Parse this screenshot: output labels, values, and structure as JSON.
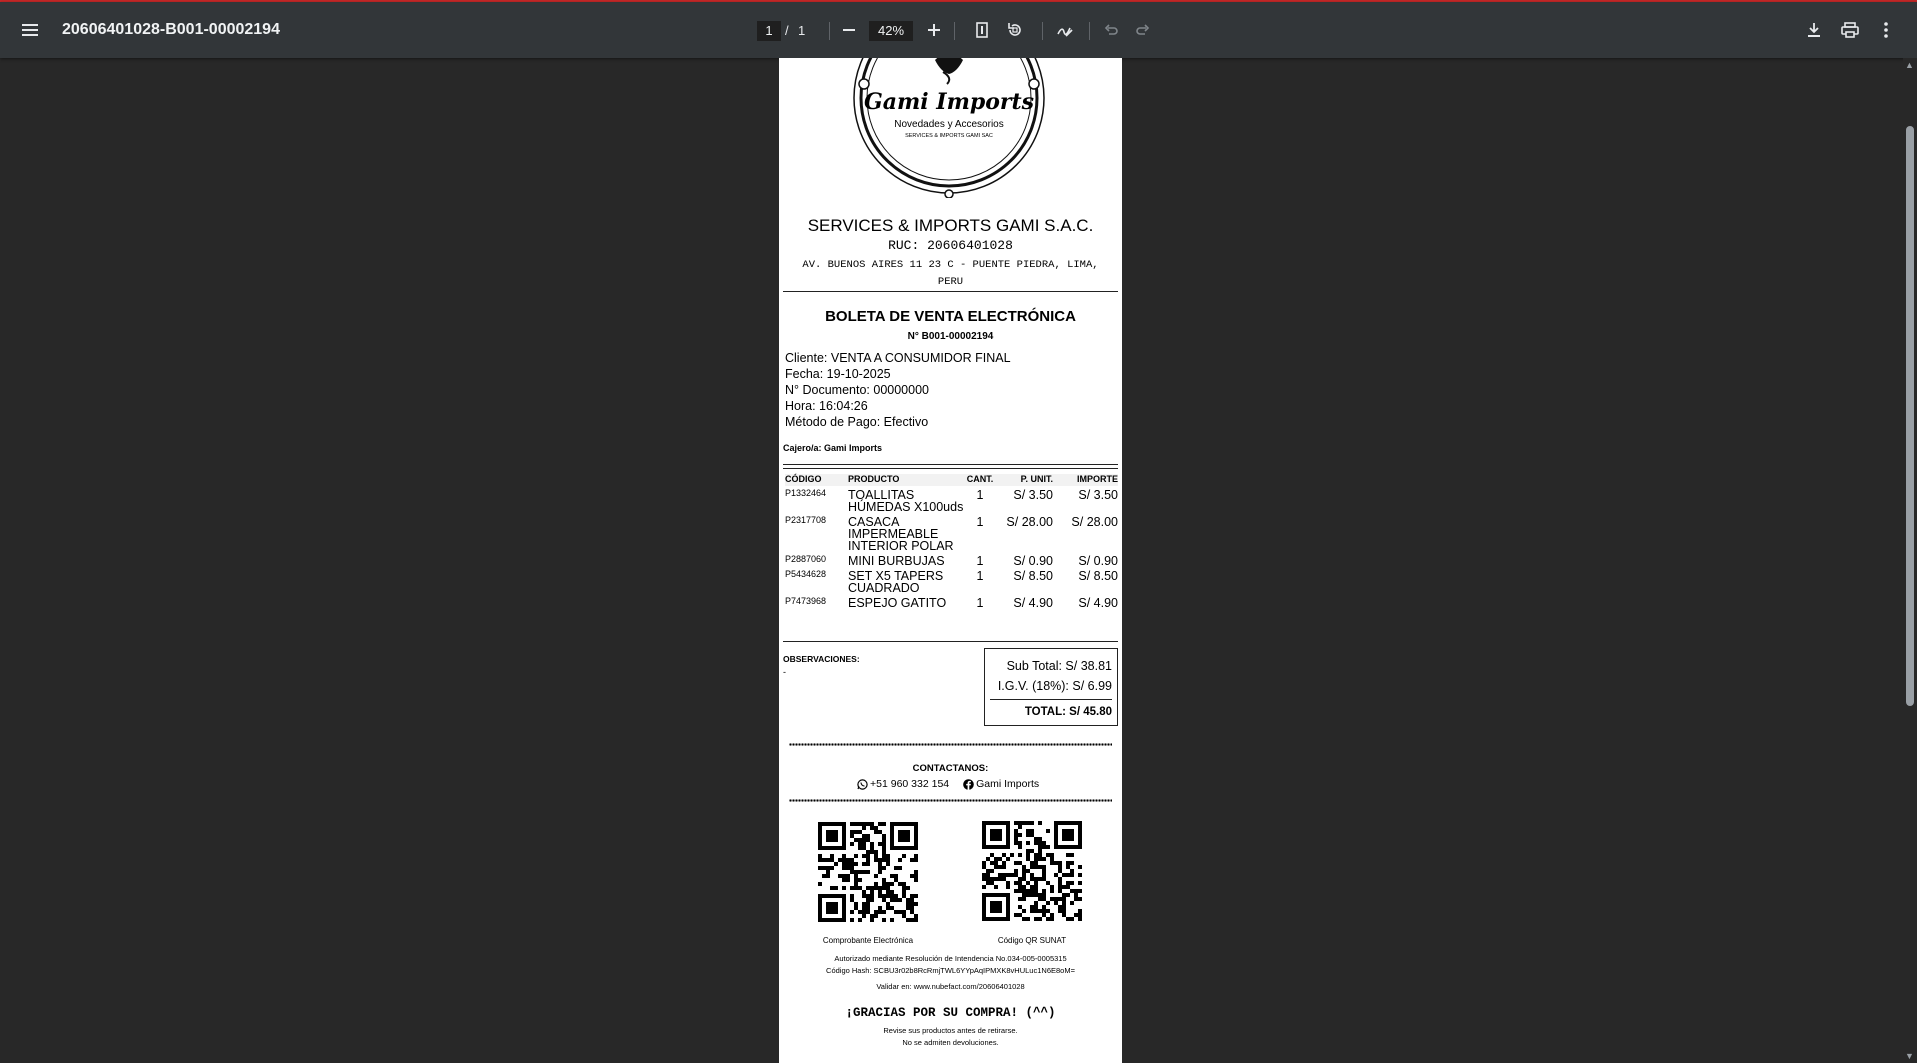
{
  "toolbar": {
    "title": "20606401028-B001-00002194",
    "current_page": "1",
    "page_separator": "/",
    "total_pages": "1",
    "zoom": "42%",
    "icons": [
      "menu-icon",
      "zoom-out-icon",
      "zoom-in-icon",
      "fit-page-icon",
      "rotate-icon",
      "annotate-icon",
      "undo-icon",
      "redo-icon",
      "download-icon",
      "print-icon",
      "more-icon"
    ]
  },
  "receipt": {
    "logo": {
      "brand": "Gami Imports",
      "tagline": "Novedades y Accesorios",
      "small": "SERVICES & IMPORTS GAMI SAC"
    },
    "company": "SERVICES & IMPORTS GAMI S.A.C.",
    "ruc": "RUC: 20606401028",
    "address": "AV. BUENOS AIRES 11 23 C - PUENTE PIEDRA, LIMA, PERU",
    "doc_title": "BOLETA DE VENTA ELECTRÓNICA",
    "doc_number": "N° B001-00002194",
    "client_lines": [
      "Cliente: VENTA A CONSUMIDOR FINAL",
      "Fecha: 19-10-2025",
      "N° Documento: 00000000",
      "Hora: 16:04:26",
      "Método de Pago: Efectivo"
    ],
    "cashier": "Cajero/a: Gami Imports",
    "table": {
      "headers": [
        "CÓDIGO",
        "PRODUCTO",
        "CANT.",
        "P. UNIT.",
        "IMPORTE"
      ],
      "rows": [
        [
          "P1332464",
          "TOALLITAS HÚMEDAS X100uds",
          "1",
          "S/ 3.50",
          "S/ 3.50"
        ],
        [
          "P2317708",
          "CASACA IMPERMEABLE INTERIOR POLAR",
          "1",
          "S/ 28.00",
          "S/ 28.00"
        ],
        [
          "P2887060",
          "MINI BURBUJAS",
          "1",
          "S/ 0.90",
          "S/ 0.90"
        ],
        [
          "P5434628",
          "SET X5 TAPERS CUADRADO",
          "1",
          "S/ 8.50",
          "S/ 8.50"
        ],
        [
          "P7473968",
          "ESPEJO GATITO",
          "1",
          "S/ 4.90",
          "S/ 4.90"
        ]
      ]
    },
    "observations_label": "OBSERVACIONES:",
    "observations_value": "-",
    "totals": {
      "subtotal": "Sub Total: S/ 38.81",
      "igv": "I.G.V. (18%): S/ 6.99",
      "total": "TOTAL: S/ 45.80"
    },
    "contact_label": "CONTACTANOS:",
    "phone": "+51 960 332 154",
    "facebook": "Gami Imports",
    "qr_left_label": "Comprobante Electrónica",
    "qr_right_label": "Código QR SUNAT",
    "authorized": "Autorizado mediante Resolución de Intendencia No.034-005-0005315",
    "hash": "Código Hash: SCBU3r02b8RcRmjTWL6YYpAqIPMXK8vHULuc1N6E8oM=",
    "validate": "Validar en:  www.nubefact.com/20606401028",
    "thanks": "¡GRACIAS POR SU COMPRA! (^^)",
    "note1": "Revise sus productos antes de retirarse.",
    "note2": "No se admiten devoluciones."
  }
}
